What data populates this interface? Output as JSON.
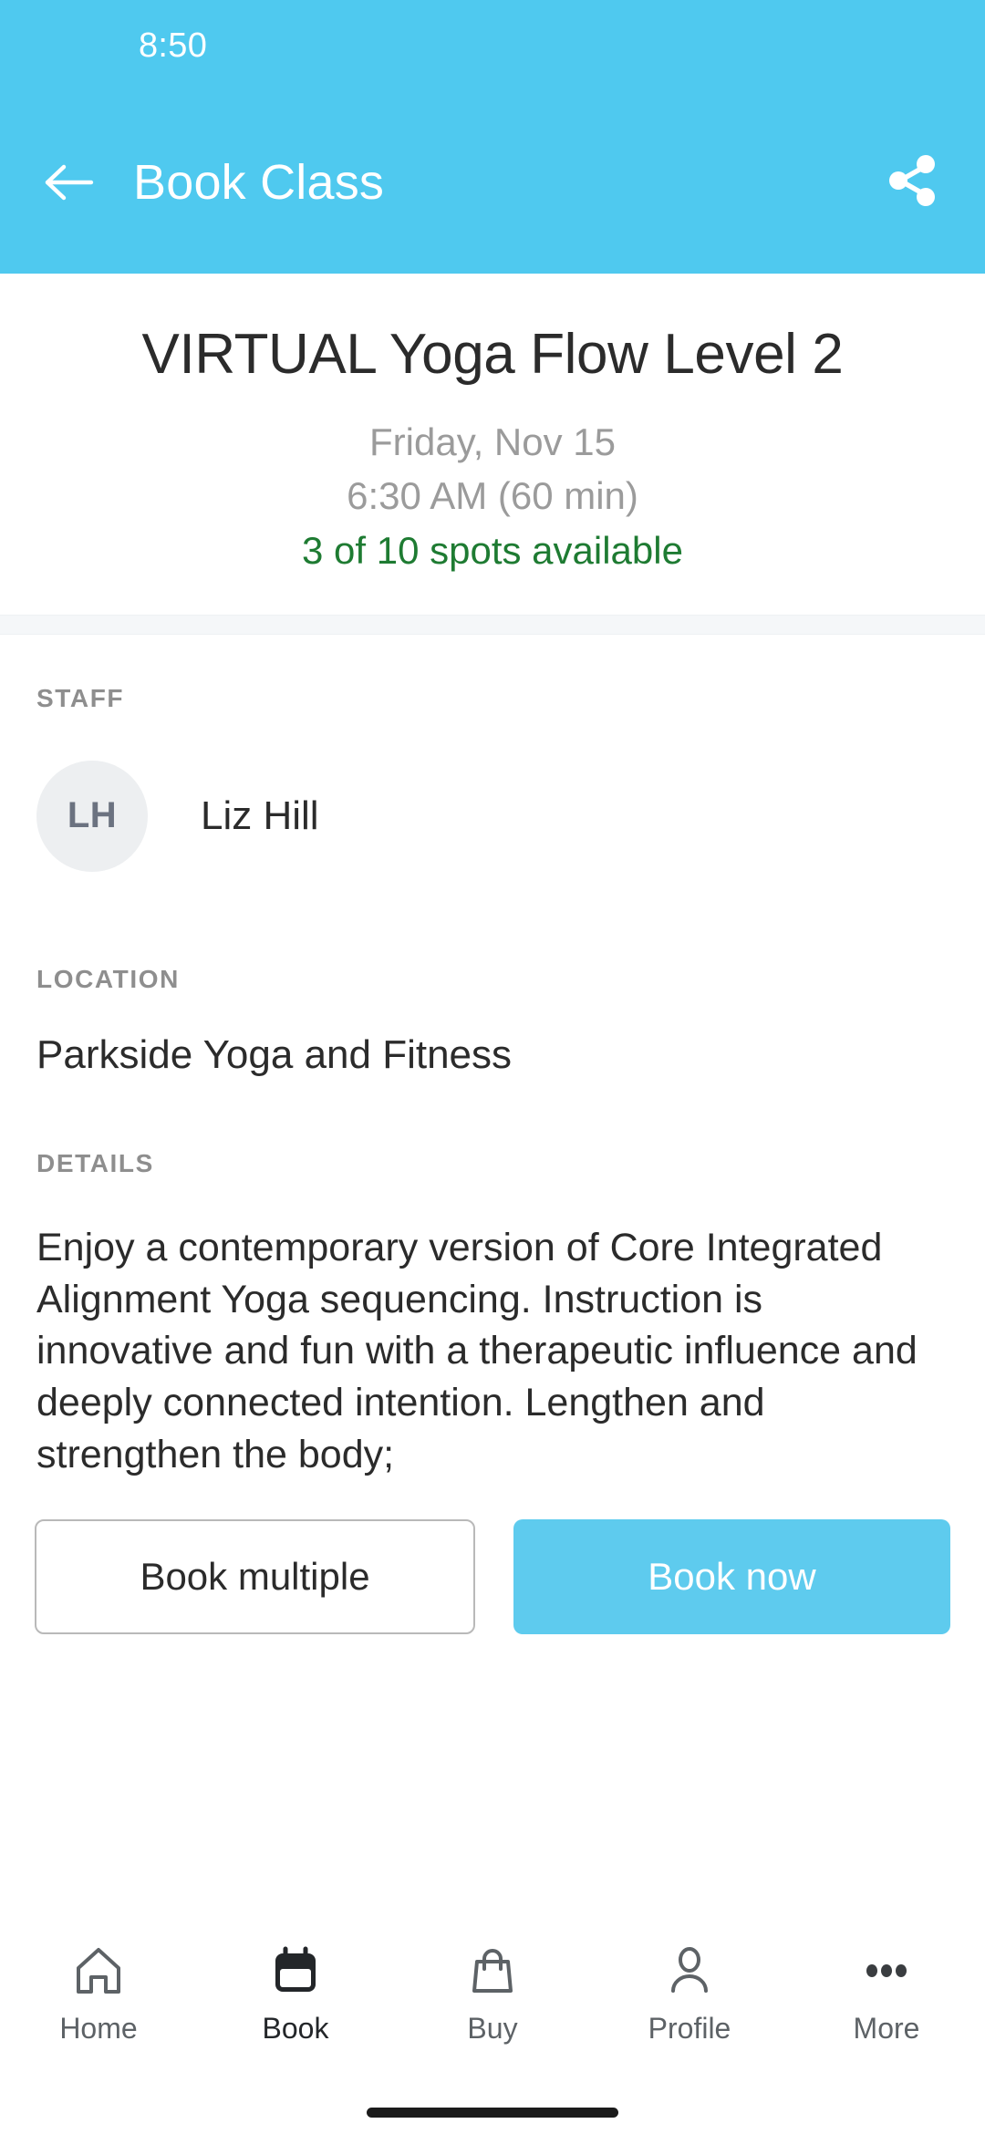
{
  "status_bar": {
    "time": "8:50"
  },
  "app_bar": {
    "title": "Book Class",
    "back_icon": "arrow-left-icon",
    "share_icon": "share-icon"
  },
  "class": {
    "title": "VIRTUAL Yoga Flow Level 2",
    "date": "Friday, Nov 15",
    "time": "6:30 AM (60 min)",
    "availability": "3 of 10 spots available",
    "spots_available": 3,
    "spots_total": 10
  },
  "sections": {
    "staff_label": "STAFF",
    "staff_initials": "LH",
    "staff_name": "Liz Hill",
    "location_label": "LOCATION",
    "location_value": "Parkside Yoga and Fitness",
    "details_label": "DETAILS",
    "details_text": "Enjoy a contemporary version of Core Integrated Alignment Yoga sequencing. Instruction is innovative and fun with a therapeutic influence and deeply connected intention. Lengthen and strengthen the body;"
  },
  "actions": {
    "book_multiple_label": "Book multiple",
    "book_now_label": "Book now"
  },
  "bottom_nav": {
    "items": [
      {
        "label": "Home",
        "icon": "home-icon"
      },
      {
        "label": "Book",
        "icon": "calendar-icon"
      },
      {
        "label": "Buy",
        "icon": "shopping-bag-icon"
      },
      {
        "label": "Profile",
        "icon": "person-icon"
      },
      {
        "label": "More",
        "icon": "ellipsis-icon"
      }
    ],
    "active_index": 1
  },
  "colors": {
    "brand_blue": "#4FC9EF",
    "button_blue": "#5ECBEE",
    "available_green": "#1E7B32",
    "muted_gray": "#9b9b9b",
    "avatar_bg": "#EDEFF1"
  }
}
